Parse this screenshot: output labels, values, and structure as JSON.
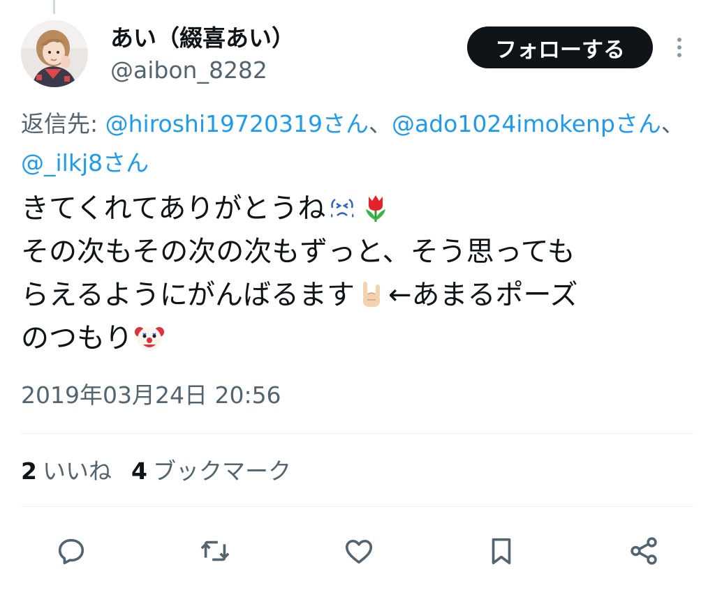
{
  "author": {
    "display_name": "あい（綴喜あい）",
    "handle": "@aibon_8282"
  },
  "follow_button_label": "フォローする",
  "reply_to": {
    "prefix": "返信先: ",
    "mention_1": "@hiroshi19720319さん",
    "sep_1": "、",
    "mention_2": "@ado1024imokenpさん",
    "sep_2": "、",
    "mention_3": "@_ilkj8さん"
  },
  "tweet": {
    "line_1": "きてくれてありがとうね",
    "line_2": "その次もその次の次もずっと、そう思っても",
    "line_3a": "らえるようにがんばるます",
    "line_3b": "←あまるポーズ",
    "line_4": "のつもり",
    "emojis": [
      "sweat-emoji",
      "tulip-emoji",
      "sign-of-horns-emoji",
      "clown-emoji"
    ]
  },
  "timestamp": "2019年03月24日 20:56",
  "stats": {
    "likes_count": "2",
    "likes_label": "いいね",
    "bookmarks_count": "4",
    "bookmarks_label": "ブックマーク"
  },
  "actions": [
    "reply-icon",
    "retweet-icon",
    "like-icon",
    "bookmark-icon",
    "share-icon"
  ],
  "colors": {
    "link": "#1d9bf0",
    "secondary_text": "#536471",
    "primary_text": "#0f1419",
    "follow_bg": "#0f1419"
  }
}
